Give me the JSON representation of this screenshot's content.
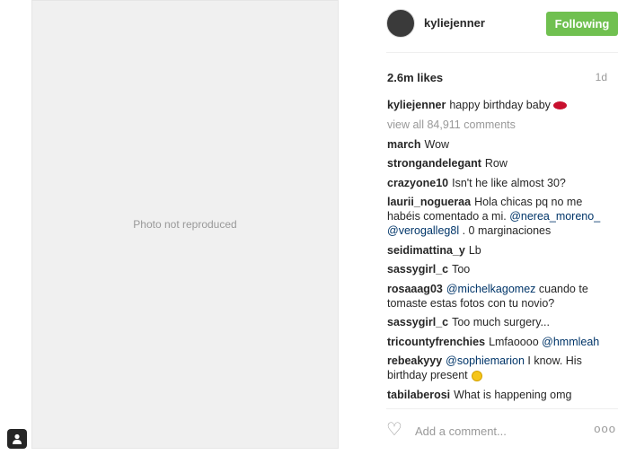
{
  "post": {
    "media_placeholder": "Photo not reproduced",
    "username": "kyliejenner",
    "follow_label": "Following",
    "likes": "2.6m likes",
    "age": "1d",
    "caption_user": "kyliejenner",
    "caption_text": "happy birthday baby",
    "view_all": "view all 84,911 comments"
  },
  "comments": [
    {
      "user": "march",
      "parts": [
        {
          "t": "Wow"
        }
      ]
    },
    {
      "user": "strongandelegant",
      "parts": [
        {
          "t": "Row"
        }
      ]
    },
    {
      "user": "crazyone10",
      "parts": [
        {
          "t": "Isn't he like almost 30?"
        }
      ]
    },
    {
      "user": "laurii_nogueraa",
      "parts": [
        {
          "t": "Hola chicas pq no me habéis comentado a mi. "
        },
        {
          "t": "@nerea_moreno_",
          "m": true
        },
        {
          "t": " "
        },
        {
          "t": "@verogalleg8l",
          "m": true
        },
        {
          "t": " . 0 marginaciones"
        }
      ]
    },
    {
      "user": "seidimattina_y",
      "parts": [
        {
          "t": "Lb"
        }
      ]
    },
    {
      "user": "sassygirl_c",
      "parts": [
        {
          "t": "Too"
        }
      ]
    },
    {
      "user": "rosaaag03",
      "parts": [
        {
          "t": "@michelkagomez",
          "m": true
        },
        {
          "t": " cuando te tomaste estas fotos con tu novio?"
        }
      ]
    },
    {
      "user": "sassygirl_c",
      "parts": [
        {
          "t": "Too much surgery..."
        }
      ]
    },
    {
      "user": "tricountyfrenchies",
      "parts": [
        {
          "t": "Lmfaoooo "
        },
        {
          "t": "@hmmleah",
          "m": true
        }
      ]
    },
    {
      "user": "rebeakyyy",
      "parts": [
        {
          "t": "@sophiemarion",
          "m": true
        },
        {
          "t": " I know. His birthday present"
        }
      ],
      "emoji": true
    },
    {
      "user": "tabilaberosi",
      "parts": [
        {
          "t": "What is happening omg"
        }
      ]
    }
  ],
  "footer": {
    "placeholder": "Add a comment...",
    "more": "ooo"
  },
  "icons": {
    "like": "heart-outline-icon",
    "tag": "person-tag-icon",
    "more": "more-options-icon"
  },
  "colors": {
    "follow_button": "#70c050",
    "mention": "#003569",
    "muted": "#999999"
  }
}
